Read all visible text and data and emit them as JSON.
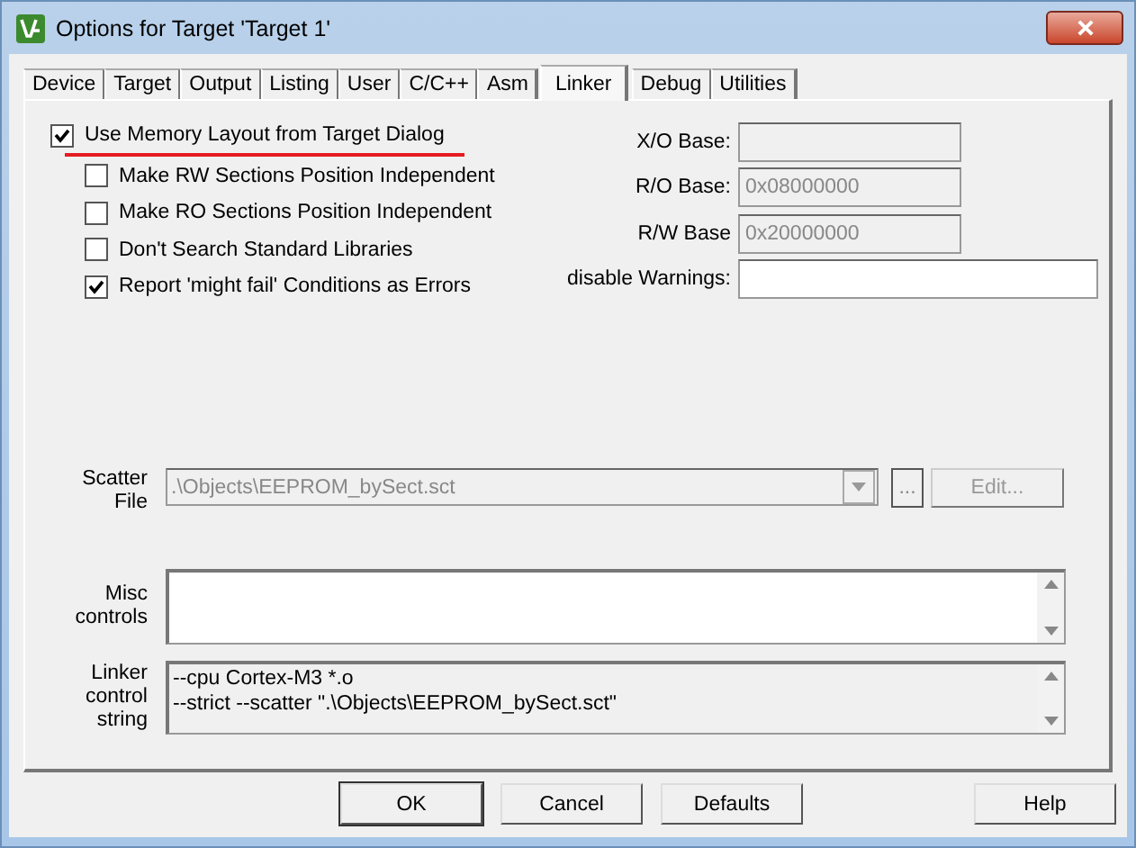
{
  "window": {
    "title": "Options for Target 'Target 1'"
  },
  "tabs": [
    {
      "label": "Device",
      "selected": false
    },
    {
      "label": "Target",
      "selected": false
    },
    {
      "label": "Output",
      "selected": false
    },
    {
      "label": "Listing",
      "selected": false
    },
    {
      "label": "User",
      "selected": false
    },
    {
      "label": "C/C++",
      "selected": false
    },
    {
      "label": "Asm",
      "selected": false
    },
    {
      "label": "Linker",
      "selected": true
    },
    {
      "label": "Debug",
      "selected": false
    },
    {
      "label": "Utilities",
      "selected": false
    }
  ],
  "memory_layout": {
    "label": "Use Memory Layout from Target Dialog",
    "checked": true
  },
  "options": [
    {
      "label": "Make RW Sections Position Independent",
      "checked": false
    },
    {
      "label": "Make RO Sections Position Independent",
      "checked": false
    },
    {
      "label": "Don't Search Standard Libraries",
      "checked": false
    },
    {
      "label": "Report 'might fail' Conditions as Errors",
      "checked": true
    }
  ],
  "base_fields": [
    {
      "label": "X/O Base:",
      "disabled": true
    },
    {
      "label": "R/O Base:",
      "value": "0x08000000",
      "disabled": true
    },
    {
      "label": "R/W Base",
      "value": "0x20000000",
      "disabled": true
    },
    {
      "label": "disable Warnings:",
      "disabled": false
    }
  ],
  "scatter_file": {
    "label": "Scatter File",
    "value": ".\\Objects\\EEPROM_bySect.sct",
    "browse": "...",
    "edit": "Edit..."
  },
  "misc_controls": {
    "label": "Misc controls"
  },
  "linker_control": {
    "label": "Linker control string",
    "lines": [
      "--cpu Cortex-M3 *.o",
      "--strict --scatter \".\\Objects\\EEPROM_bySect.sct\""
    ]
  },
  "buttons": [
    "OK",
    "Cancel",
    "Defaults",
    "Help"
  ]
}
